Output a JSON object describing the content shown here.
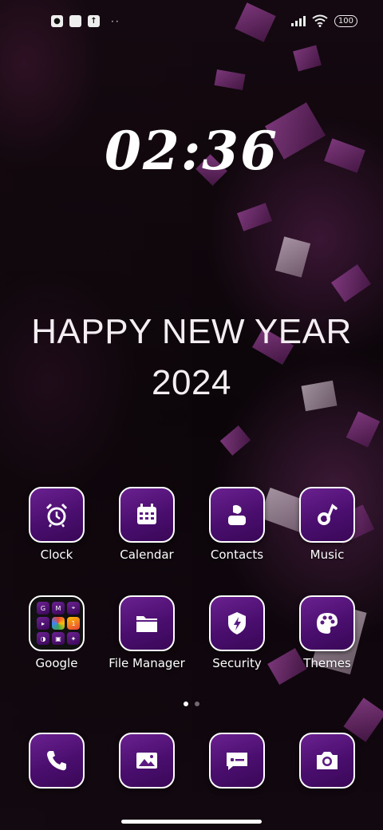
{
  "status_bar": {
    "left_icons": [
      "notification-icon",
      "square-icon",
      "upload-icon"
    ],
    "dots": "··",
    "battery": "100"
  },
  "clock": {
    "time": "02:36"
  },
  "greeting": {
    "line1": "HAPPY NEW YEAR",
    "line2": "2024"
  },
  "apps_row1": [
    {
      "label": "Clock",
      "icon": "alarm-clock-icon"
    },
    {
      "label": "Calendar",
      "icon": "calendar-icon"
    },
    {
      "label": "Contacts",
      "icon": "contacts-icon"
    },
    {
      "label": "Music",
      "icon": "music-icon"
    }
  ],
  "apps_row2": [
    {
      "label": "Google",
      "icon": "folder-icon"
    },
    {
      "label": "File Manager",
      "icon": "file-folder-icon"
    },
    {
      "label": "Security",
      "icon": "shield-icon"
    },
    {
      "label": "Themes",
      "icon": "palette-icon"
    }
  ],
  "google_folder": {
    "minis": [
      "G",
      "M",
      "⌖",
      "▸",
      "◐",
      "1",
      "◑",
      "▣",
      "✦"
    ]
  },
  "pager": {
    "pages": 2,
    "active": 0
  },
  "dock": [
    "phone-icon",
    "gallery-icon",
    "messages-icon",
    "camera-icon"
  ],
  "colors": {
    "tile": "#4a0e6e",
    "tile_border": "#ffffff"
  }
}
